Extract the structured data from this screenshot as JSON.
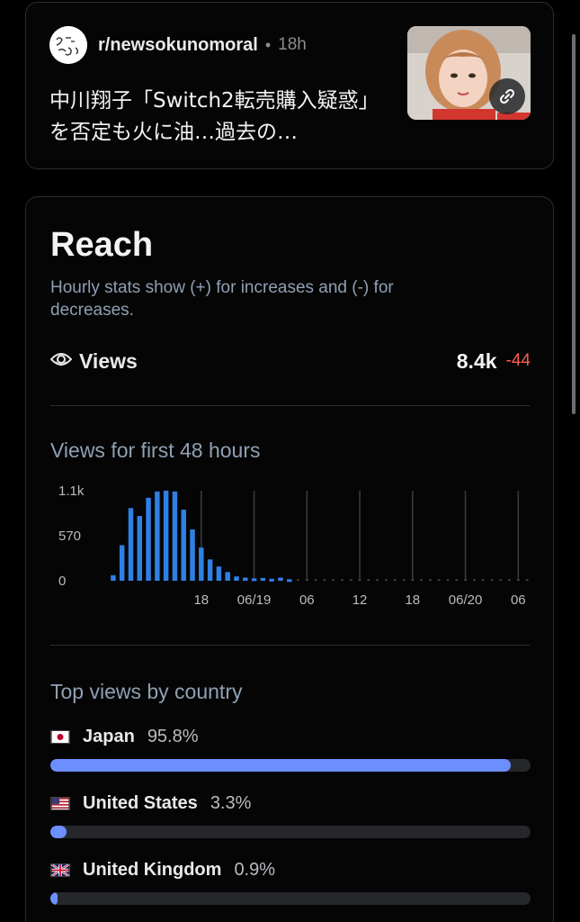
{
  "post": {
    "subreddit": "r/newsokunomoral",
    "separator": "•",
    "time": "18h",
    "title": "中川翔子「Switch2転売購入疑惑」を否定も火に油…過去の…",
    "avatar_icon": "subreddit-avatar-icon",
    "link_icon": "link-icon"
  },
  "reach": {
    "title": "Reach",
    "subtitle": "Hourly stats show (+) for increases and (-) for decreases.",
    "views_icon": "eye-icon",
    "views_label": "Views",
    "views_value": "8.4k",
    "views_delta": "-44",
    "delta_color": "#ff5a4f"
  },
  "chart_data": {
    "type": "bar",
    "title": "Views for first 48 hours",
    "y_ticks": [
      "1.1k",
      "570",
      "0"
    ],
    "ylim": [
      0,
      1140
    ],
    "x_ticks": [
      {
        "hour": 10,
        "label": "18"
      },
      {
        "hour": 16,
        "label": "06/19"
      },
      {
        "hour": 22,
        "label": "06"
      },
      {
        "hour": 28,
        "label": "12"
      },
      {
        "hour": 34,
        "label": "18"
      },
      {
        "hour": 40,
        "label": "06/20"
      },
      {
        "hour": 46,
        "label": "06"
      }
    ],
    "values": [
      70,
      450,
      920,
      820,
      1050,
      1130,
      1140,
      1130,
      900,
      650,
      420,
      270,
      180,
      110,
      55,
      40,
      30,
      35,
      25,
      40,
      20,
      0,
      0,
      0,
      0,
      0,
      0,
      0,
      0,
      0,
      0,
      0,
      0,
      0,
      0,
      0,
      0,
      0,
      0,
      0,
      0,
      0,
      0,
      0,
      0,
      0,
      0,
      0
    ],
    "bar_color": "#2f80e4",
    "grid_color": "#3a3d42"
  },
  "countries": {
    "title": "Top views by country",
    "items": [
      {
        "name": "Japan",
        "percent": "95.8%",
        "fraction": 0.958,
        "flag": "jp"
      },
      {
        "name": "United States",
        "percent": "3.3%",
        "fraction": 0.033,
        "flag": "us"
      },
      {
        "name": "United Kingdom",
        "percent": "0.9%",
        "fraction": 0.009,
        "flag": "gb"
      }
    ],
    "bar_color": "#6b8fff"
  }
}
